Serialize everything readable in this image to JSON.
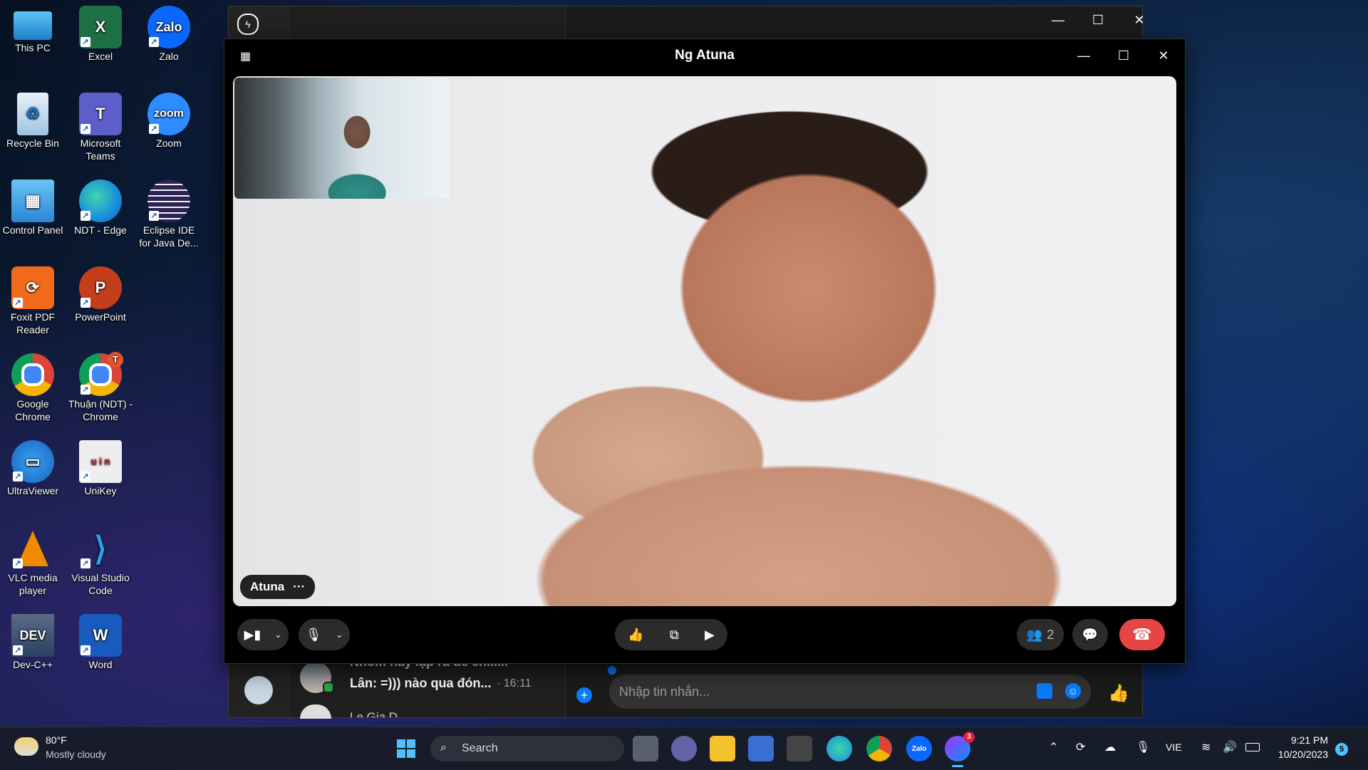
{
  "desktop": {
    "icons": [
      {
        "label": "This PC"
      },
      {
        "label": "Excel"
      },
      {
        "label": "Zalo"
      },
      {
        "label": "Recycle Bin"
      },
      {
        "label": "Microsoft Teams"
      },
      {
        "label": "Zoom"
      },
      {
        "label": "Control Panel"
      },
      {
        "label": "NDT - Edge"
      },
      {
        "label": "Eclipse IDE for Java De..."
      },
      {
        "label": "Foxit PDF Reader"
      },
      {
        "label": "PowerPoint"
      },
      {
        "label": "Google Chrome"
      },
      {
        "label": "Thuận (NDT) - Chrome"
      },
      {
        "label": "UltraViewer"
      },
      {
        "label": "UniKey"
      },
      {
        "label": "VLC media player"
      },
      {
        "label": "Visual Studio Code"
      },
      {
        "label": "Dev-C++"
      },
      {
        "label": "Word"
      }
    ],
    "icon_glyphs": {
      "excel": "X",
      "powerpoint": "P",
      "word": "W",
      "teams": "T",
      "zalo": "Zalo",
      "zoom": "zoom",
      "dev": "DEV",
      "chrome_badge": "T",
      "unikey": "u i n"
    }
  },
  "messenger_back": {
    "chat_preview_top": "Nhóm hay lập ra để chill...",
    "chat_preview_message": "Lân: =))) nào qua đón...",
    "chat_preview_time": "· 16:11",
    "chat_preview_next": "Le Gia D...",
    "message_placeholder": "Nhập tin nhắn..."
  },
  "call": {
    "title": "Ng Atuna",
    "participant_name": "Atuna",
    "participant_more": "···",
    "participants_count": "2"
  },
  "taskbar": {
    "weather_temp": "80°F",
    "weather_desc": "Mostly cloudy",
    "search_label": "Search",
    "language": "VIE",
    "time": "9:21 PM",
    "date": "10/20/2023",
    "notification_count": "5",
    "messenger_badge": "3"
  },
  "colors": {
    "end_call": "#e64545",
    "accent_blue": "#0a7cff",
    "call_bg": "#000000"
  }
}
